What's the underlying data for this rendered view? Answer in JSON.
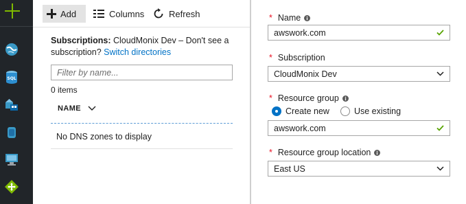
{
  "nav_rail": {
    "items": [
      "plus-icon",
      "dns-globe-icon",
      "sql-database-icon",
      "cloud-services-icon",
      "storage-cylinder-icon",
      "virtual-machine-icon",
      "network-arrows-icon"
    ]
  },
  "toolbar": {
    "add_label": "Add",
    "columns_label": "Columns",
    "refresh_label": "Refresh"
  },
  "subscriptions": {
    "prefix": "Subscriptions:",
    "text": "CloudMonix Dev – Don't see a subscription?",
    "link": "Switch directories"
  },
  "filter": {
    "placeholder": "Filter by name..."
  },
  "list": {
    "count": "0 items",
    "column_header": "NAME",
    "empty_message": "No DNS zones to display"
  },
  "form": {
    "name_label": "Name",
    "name_value": "awswork.com",
    "subscription_label": "Subscription",
    "subscription_value": "CloudMonix Dev",
    "resource_group_label": "Resource group",
    "radio_create_new": "Create new",
    "radio_use_existing": "Use existing",
    "resource_group_value": "awswork.com",
    "location_label": "Resource group location",
    "location_value": "East US"
  },
  "colors": {
    "accent": "#0072c6",
    "success": "#57a300",
    "required": "#e81123",
    "rail": "#212529",
    "brand_green": "#7fba00"
  }
}
